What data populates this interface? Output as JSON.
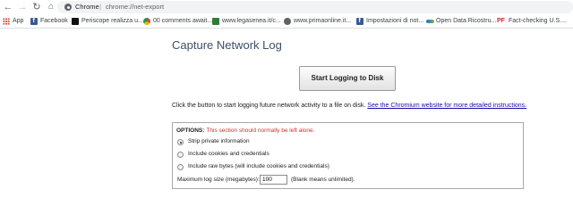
{
  "toolbar": {
    "back_icon": "arrow-left-icon",
    "forward_icon": "arrow-right-icon",
    "reload_icon": "reload-icon",
    "home_icon": "home-icon",
    "site_label": "Chrome",
    "separator": "|",
    "url": "chrome://net-export"
  },
  "bookmarks": [
    {
      "label": "App",
      "icon": "apps-grid-icon"
    },
    {
      "label": "Facebook",
      "icon": "facebook-icon"
    },
    {
      "label": "Periscope realizza u...",
      "icon": "periscope-icon"
    },
    {
      "label": "00 comments await...",
      "icon": "chrome-icon"
    },
    {
      "label": "www.legasenea.it/c...",
      "icon": "site-icon"
    },
    {
      "label": "www.primaonline.it...",
      "icon": "globe-icon"
    },
    {
      "label": "Impostazioni di not...",
      "icon": "facebook-icon"
    },
    {
      "label": "Open Data Ricostru...",
      "icon": "opendata-icon"
    },
    {
      "label": "Fact-checking U.S....",
      "icon": "politifact-icon"
    }
  ],
  "page": {
    "title": "Capture Network Log",
    "start_button": "Start Logging to Disk",
    "instructions": "Click the button to start logging future network activity to a file on disk.",
    "instructions_link": "See the Chromium website for more detailed instructions."
  },
  "options": {
    "label": "OPTIONS:",
    "warning": "This section should normally be left alone.",
    "radios": [
      {
        "label": "Strip private information",
        "checked": true
      },
      {
        "label": "Include cookies and credentials",
        "checked": false
      },
      {
        "label": "Include raw bytes (will include cookies and credentials)",
        "checked": false
      }
    ],
    "size_label": "Maximum log size (megabytes):",
    "size_value": "100",
    "size_hint": "(Blank means unlimited)."
  }
}
